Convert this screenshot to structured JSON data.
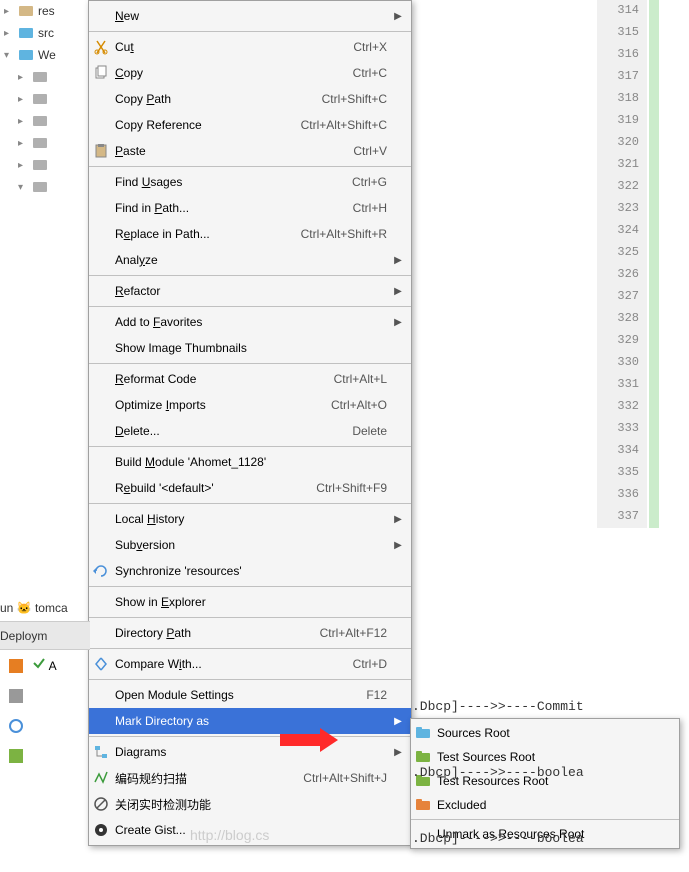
{
  "tree": {
    "items": [
      {
        "arrow": "▸",
        "iconColor": "folder-tan",
        "label": "res"
      },
      {
        "arrow": "▸",
        "iconColor": "folder-blue",
        "label": "src"
      },
      {
        "arrow": "▾",
        "iconColor": "folder-blue",
        "label": "We"
      },
      {
        "arrow": "▸",
        "iconColor": "folder-gray",
        "label": ""
      },
      {
        "arrow": "▸",
        "iconColor": "folder-gray",
        "label": ""
      },
      {
        "arrow": "▸",
        "iconColor": "folder-gray",
        "label": ""
      },
      {
        "arrow": "▸",
        "iconColor": "folder-gray",
        "label": ""
      },
      {
        "arrow": "▸",
        "iconColor": "folder-gray",
        "label": ""
      },
      {
        "arrow": "▾",
        "iconColor": "folder-gray",
        "label": ""
      }
    ]
  },
  "menu": {
    "items": [
      {
        "label": "New",
        "underline": 0,
        "shortcut": "",
        "arrow": true,
        "icon": ""
      },
      {
        "sep": true
      },
      {
        "label": "Cut",
        "underline": 2,
        "shortcut": "Ctrl+X",
        "icon": "cut-icon"
      },
      {
        "label": "Copy",
        "underline": 0,
        "shortcut": "Ctrl+C",
        "icon": "copy-icon"
      },
      {
        "label": "Copy Path",
        "underline": 5,
        "shortcut": "Ctrl+Shift+C",
        "icon": ""
      },
      {
        "label": "Copy Reference",
        "underline": -1,
        "shortcut": "Ctrl+Alt+Shift+C",
        "icon": ""
      },
      {
        "label": "Paste",
        "underline": 0,
        "shortcut": "Ctrl+V",
        "icon": "paste-icon"
      },
      {
        "sep": true
      },
      {
        "label": "Find Usages",
        "underline": 5,
        "shortcut": "Ctrl+G",
        "icon": ""
      },
      {
        "label": "Find in Path...",
        "underline": 8,
        "shortcut": "Ctrl+H",
        "icon": ""
      },
      {
        "label": "Replace in Path...",
        "underline": 1,
        "shortcut": "Ctrl+Alt+Shift+R",
        "icon": ""
      },
      {
        "label": "Analyze",
        "underline": 4,
        "shortcut": "",
        "arrow": true,
        "icon": ""
      },
      {
        "sep": true
      },
      {
        "label": "Refactor",
        "underline": 0,
        "shortcut": "",
        "arrow": true,
        "icon": ""
      },
      {
        "sep": true
      },
      {
        "label": "Add to Favorites",
        "underline": 7,
        "shortcut": "",
        "arrow": true,
        "icon": ""
      },
      {
        "label": "Show Image Thumbnails",
        "underline": -1,
        "shortcut": "",
        "icon": ""
      },
      {
        "sep": true
      },
      {
        "label": "Reformat Code",
        "underline": 0,
        "shortcut": "Ctrl+Alt+L",
        "icon": ""
      },
      {
        "label": "Optimize Imports",
        "underline": 9,
        "shortcut": "Ctrl+Alt+O",
        "icon": ""
      },
      {
        "label": "Delete...",
        "underline": 0,
        "shortcut": "Delete",
        "icon": ""
      },
      {
        "sep": true
      },
      {
        "label": "Build Module 'Ahomet_1128'",
        "underline": 6,
        "shortcut": "",
        "icon": ""
      },
      {
        "label": "Rebuild '<default>'",
        "underline": 1,
        "shortcut": "Ctrl+Shift+F9",
        "icon": ""
      },
      {
        "sep": true
      },
      {
        "label": "Local History",
        "underline": 6,
        "shortcut": "",
        "arrow": true,
        "icon": ""
      },
      {
        "label": "Subversion",
        "underline": 3,
        "shortcut": "",
        "arrow": true,
        "icon": ""
      },
      {
        "label": "Synchronize 'resources'",
        "underline": -1,
        "shortcut": "",
        "icon": "sync-icon"
      },
      {
        "sep": true
      },
      {
        "label": "Show in Explorer",
        "underline": 8,
        "shortcut": "",
        "icon": ""
      },
      {
        "sep": true
      },
      {
        "label": "Directory Path",
        "underline": 10,
        "shortcut": "Ctrl+Alt+F12",
        "icon": ""
      },
      {
        "sep": true
      },
      {
        "label": "Compare With...",
        "underline": 9,
        "shortcut": "Ctrl+D",
        "icon": "compare-icon"
      },
      {
        "sep": true
      },
      {
        "label": "Open Module Settings",
        "underline": -1,
        "shortcut": "F12",
        "icon": ""
      },
      {
        "label": "Mark Directory as",
        "underline": -1,
        "shortcut": "",
        "arrow": true,
        "icon": "",
        "highlighted": true
      },
      {
        "sep": true
      },
      {
        "label": "Diagrams",
        "underline": 3,
        "shortcut": "",
        "arrow": true,
        "icon": "diagram-icon"
      },
      {
        "label": "编码规约扫描",
        "underline": -1,
        "shortcut": "Ctrl+Alt+Shift+J",
        "icon": "scan-icon"
      },
      {
        "label": "关闭实时检测功能",
        "underline": -1,
        "shortcut": "",
        "icon": "block-icon"
      },
      {
        "label": "Create Gist...",
        "underline": -1,
        "shortcut": "",
        "icon": "gist-icon"
      }
    ]
  },
  "submenu": {
    "items": [
      {
        "label": "Sources Root",
        "icon": "folder-blue-icon",
        "color": "#5fb4e0"
      },
      {
        "label": "Test Sources Root",
        "icon": "folder-green-icon",
        "color": "#7cb342"
      },
      {
        "label": "Test Resources Root",
        "icon": "folder-green2-icon",
        "color": "#7cb342"
      },
      {
        "label": "Excluded",
        "icon": "folder-orange-icon",
        "color": "#e6833c"
      },
      {
        "sep": true
      },
      {
        "label": "Unmark as Resources Root",
        "icon": "",
        "color": ""
      }
    ]
  },
  "gutter": {
    "start": 314,
    "end": 337
  },
  "bottom": {
    "tab1": "un 🐱 tomca",
    "tab2": "Deploym",
    "checkLabel": "A"
  },
  "code": {
    "line1": ".Dbcp]---->>----Commit",
    "line2": ".Dbcp]---->>----boolea",
    "line3": ".Dbcp]---->>----boolea"
  },
  "watermark": "http://blog.cs"
}
